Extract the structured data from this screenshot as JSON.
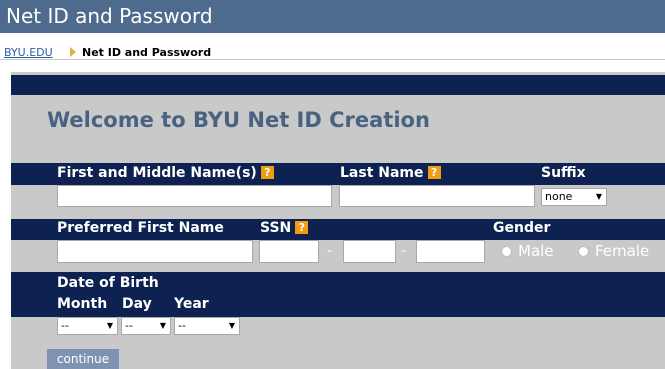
{
  "header": {
    "title": "Net ID and Password"
  },
  "breadcrumb": {
    "home": "BYU.EDU",
    "current": "Net ID and Password"
  },
  "main": {
    "heading": "Welcome to BYU Net ID Creation"
  },
  "form": {
    "first_middle_label": "First and Middle Name(s)",
    "last_name_label": "Last Name",
    "suffix_label": "Suffix",
    "suffix_value": "none",
    "preferred_label": "Preferred First Name",
    "ssn_label": "SSN",
    "ssn_separator": "-",
    "gender_label": "Gender",
    "gender_male": "Male",
    "gender_female": "Female",
    "dob_label": "Date of Birth",
    "month_label": "Month",
    "day_label": "Day",
    "year_label": "Year",
    "month_value": "--",
    "day_value": "--",
    "year_value": "--",
    "help_glyph": "?",
    "continue_label": "continue"
  },
  "colors": {
    "title_bar": "#4e6a8c",
    "form_bar": "#0d2250",
    "panel": "#c9c9c9",
    "help_icon": "#f39c12",
    "button": "#7e93b2"
  },
  "icons": {
    "help": "help-icon",
    "breadcrumb_separator": "triangle-right-icon",
    "select_arrow": "caret-down-icon"
  }
}
